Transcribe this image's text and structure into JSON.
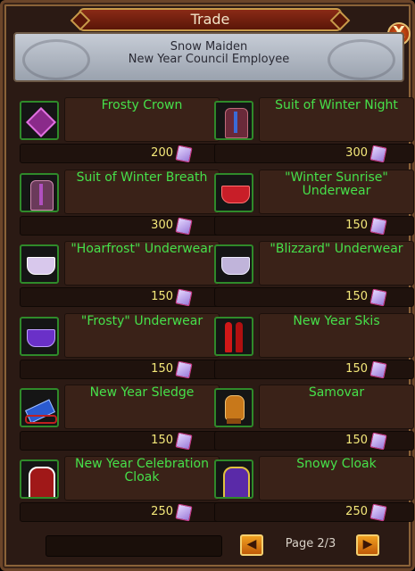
{
  "window": {
    "title": "Trade",
    "close_label": "X"
  },
  "npc": {
    "name": "Snow Maiden",
    "role": "New Year Council Employee"
  },
  "currency_icon": "crystal-icon",
  "colors": {
    "item_name": "#46e04a",
    "price": "#f4e87a",
    "frame": "#8a6238",
    "title_bg": "#8a2a16"
  },
  "items": [
    {
      "name": "Frosty Crown",
      "price": "200",
      "icon": "crown-icon"
    },
    {
      "name": "Suit of Winter Night",
      "price": "300",
      "icon": "suit-icon"
    },
    {
      "name": "Suit of Winter Breath",
      "price": "300",
      "icon": "suit-icon"
    },
    {
      "name": "\"Winter Sunrise\" Underwear",
      "price": "150",
      "icon": "underwear-icon"
    },
    {
      "name": "\"Hoarfrost\" Underwear",
      "price": "150",
      "icon": "underwear-icon"
    },
    {
      "name": "\"Blizzard\" Underwear",
      "price": "150",
      "icon": "underwear-icon"
    },
    {
      "name": "\"Frosty\" Underwear",
      "price": "150",
      "icon": "underwear-icon"
    },
    {
      "name": "New Year Skis",
      "price": "150",
      "icon": "skis-icon"
    },
    {
      "name": "New Year Sledge",
      "price": "150",
      "icon": "sledge-icon"
    },
    {
      "name": "Samovar",
      "price": "150",
      "icon": "samovar-icon"
    },
    {
      "name": "New Year Celebration Cloak",
      "price": "250",
      "icon": "cloak-icon"
    },
    {
      "name": "Snowy Cloak",
      "price": "250",
      "icon": "cloak-icon"
    }
  ],
  "pagination": {
    "label": "Page 2/3",
    "prev_label": "◀",
    "next_label": "▶"
  }
}
